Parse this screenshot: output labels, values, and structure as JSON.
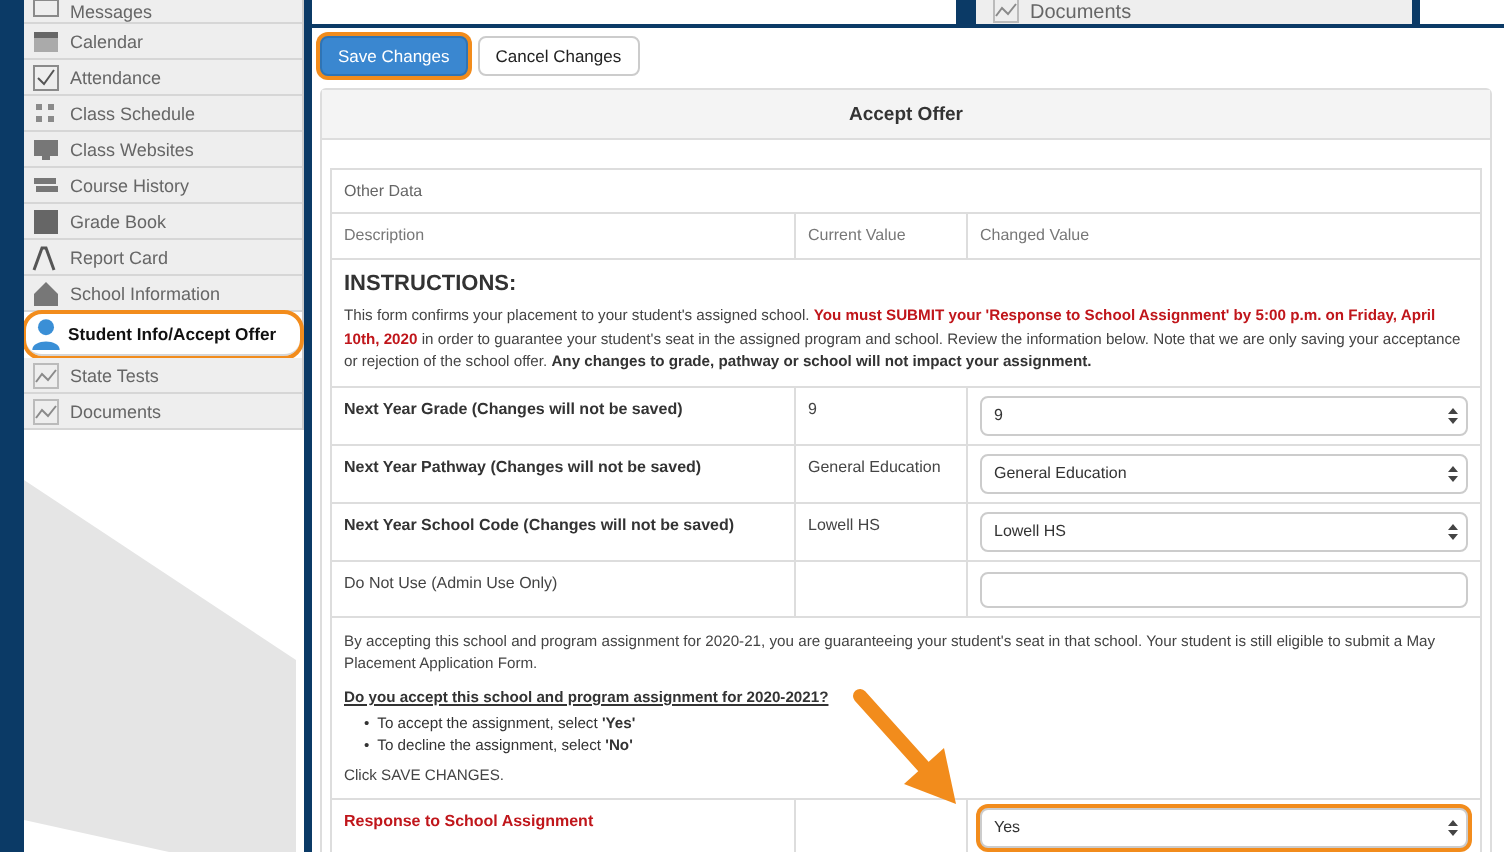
{
  "background_window": {
    "sidebar_item": "Documents"
  },
  "sidebar": {
    "items": [
      {
        "label": "Messages",
        "selected": false
      },
      {
        "label": "Calendar",
        "selected": false
      },
      {
        "label": "Attendance",
        "selected": false
      },
      {
        "label": "Class Schedule",
        "selected": false
      },
      {
        "label": "Class Websites",
        "selected": false
      },
      {
        "label": "Course History",
        "selected": false
      },
      {
        "label": "Grade Book",
        "selected": false
      },
      {
        "label": "Report Card",
        "selected": false
      },
      {
        "label": "School Information",
        "selected": false
      },
      {
        "label": "Student Info/Accept Offer",
        "selected": true
      },
      {
        "label": "State Tests",
        "selected": false
      },
      {
        "label": "Documents",
        "selected": false
      }
    ]
  },
  "toolbar": {
    "buttons": [
      {
        "label": "Save Changes",
        "kind": "primary",
        "highlighted": true
      },
      {
        "label": "Cancel Changes",
        "kind": "default",
        "highlighted": false
      }
    ]
  },
  "panel": {
    "title": "Accept Offer",
    "section": "Other Data",
    "columns": [
      "Description",
      "Current Value",
      "Changed Value"
    ],
    "instructions": {
      "heading": "INSTRUCTIONS:",
      "parts": [
        {
          "kind": "plain",
          "text": "This form confirms your placement to your student's assigned school. "
        },
        {
          "kind": "alert",
          "text": "You must SUBMIT your 'Response to School Assignment' by 5:00 p.m. on Friday, April 10th, 2020"
        },
        {
          "kind": "plain",
          "text": " in order to guarantee your student's seat in the assigned program and school. Review the information below. Note that we are only saving your acceptance or rejection of the school offer. "
        },
        {
          "kind": "bold",
          "text": "Any changes to grade, pathway or school will not impact your assignment."
        }
      ]
    },
    "rows": [
      {
        "label": "Next Year Grade (Changes will not be saved)",
        "current": "9",
        "kind": "select",
        "value": "9"
      },
      {
        "label": "Next Year Pathway (Changes will not be saved)",
        "current": "General Education",
        "kind": "select",
        "value": "General Education"
      },
      {
        "label": "Next Year School Code (Changes will not be saved)",
        "current": "Lowell HS",
        "kind": "select",
        "value": "Lowell HS"
      },
      {
        "label": "Do Not Use (Admin Use Only)",
        "current": "",
        "kind": "input"
      }
    ],
    "note": {
      "text": "By accepting this school and program assignment for 2020-21, you are guaranteeing your student's seat in that school. Your student is still eligible to submit a May Placement Application Form.",
      "question": "Do you accept this school and program assignment for 2020-2021?",
      "bullets": [
        {
          "marker": "•",
          "text": "To accept the assignment, select **'Yes'**"
        },
        {
          "marker": "•",
          "text": "To decline the assignment, select **'No'**"
        }
      ],
      "closing": "Click SAVE CHANGES."
    },
    "response": {
      "label": "Response to School Assignment",
      "alert": true,
      "kind": "select",
      "value": "Yes",
      "highlighted": true
    }
  }
}
